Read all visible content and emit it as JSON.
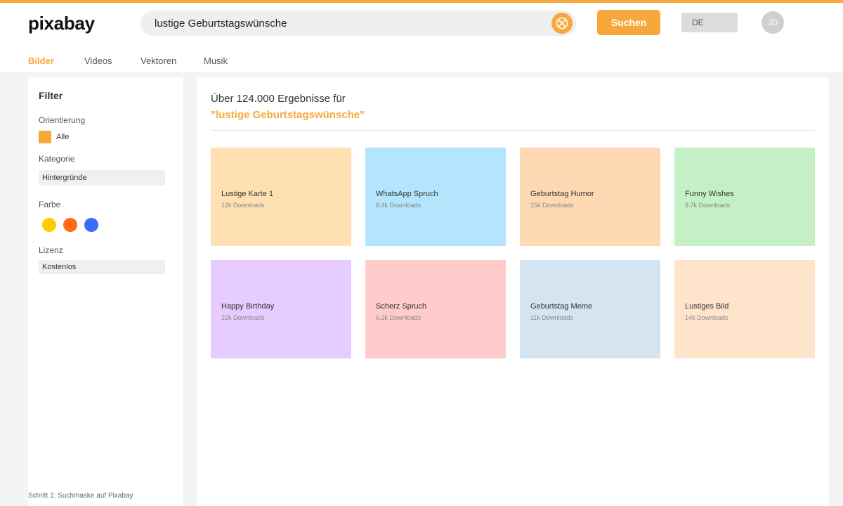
{
  "header": {
    "logo": "pixabay",
    "search": {
      "value": "lustige Geburtstagswünsche"
    },
    "search_button": "Suchen",
    "language": "DE",
    "avatar_initials": "JD",
    "accent_color": "#f7a83c"
  },
  "tabs": [
    "Bilder",
    "Videos",
    "Vektoren",
    "Musik"
  ],
  "sidebar": {
    "title": "Filter",
    "orientation": {
      "label": "Orientierung",
      "value": "Alle"
    },
    "category": {
      "label": "Kategorie",
      "value": "Hintergründe"
    },
    "color": {
      "label": "Farbe",
      "swatches": [
        "#ffcc00",
        "#ff6a13",
        "#3b6cf6"
      ]
    },
    "license": {
      "label": "Lizenz",
      "value": "Kostenlos"
    }
  },
  "results": {
    "count_text": "Über 124.000 Ergebnisse für",
    "query_text": "\"lustige Geburtstagswünsche\"",
    "cards": [
      {
        "title": "Lustige Karte 1",
        "meta": "12k Downloads",
        "color": "#ffe0b2"
      },
      {
        "title": "WhatsApp Spruch",
        "meta": "8.4k Downloads",
        "color": "#b3e5fc"
      },
      {
        "title": "Geburtstag Humor",
        "meta": "15k Downloads",
        "color": "#ffd8b4"
      },
      {
        "title": "Funny Wishes",
        "meta": "9.7k Downloads",
        "color": "#c5f0c5"
      },
      {
        "title": "Happy Birthday",
        "meta": "22k Downloads",
        "color": "#e6ccff"
      },
      {
        "title": "Scherz Spruch",
        "meta": "6.2k Downloads",
        "color": "#ffcccb"
      },
      {
        "title": "Geburtstag Meme",
        "meta": "11k Downloads",
        "color": "#d4e4f0"
      },
      {
        "title": "Lustiges Bild",
        "meta": "14k Downloads",
        "color": "#ffe4cc"
      }
    ]
  },
  "caption": "Schritt 1: Suchmaske auf Pixabay"
}
